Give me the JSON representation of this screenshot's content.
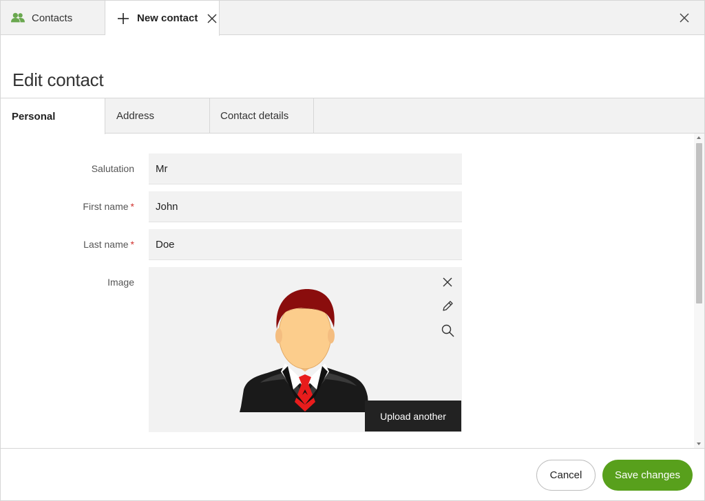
{
  "tabs": {
    "contacts_label": "Contacts",
    "new_contact_label": "New contact"
  },
  "page": {
    "title": "Edit contact"
  },
  "inner_tabs": [
    {
      "label": "Personal",
      "active": true
    },
    {
      "label": "Address",
      "active": false
    },
    {
      "label": "Contact details",
      "active": false
    }
  ],
  "form": {
    "salutation": {
      "label": "Salutation",
      "value": "Mr",
      "required": false
    },
    "first_name": {
      "label": "First name",
      "value": "John",
      "required": true,
      "required_mark": "*"
    },
    "last_name": {
      "label": "Last name",
      "value": "Doe",
      "required": true,
      "required_mark": "*"
    },
    "image": {
      "label": "Image",
      "upload_label": "Upload another"
    }
  },
  "footer": {
    "cancel_label": "Cancel",
    "save_label": "Save changes"
  },
  "icons": {
    "contacts": "people-icon",
    "new_tab": "plus-icon",
    "tab_close": "close-icon",
    "window_close": "close-icon",
    "image_remove": "close-icon",
    "image_edit": "pencil-icon",
    "image_zoom": "magnifier-icon"
  },
  "colors": {
    "accent_green": "#58a01c",
    "contacts_icon": "#6aa84f",
    "required_star": "#d0312d",
    "upload_button": "#222222"
  }
}
